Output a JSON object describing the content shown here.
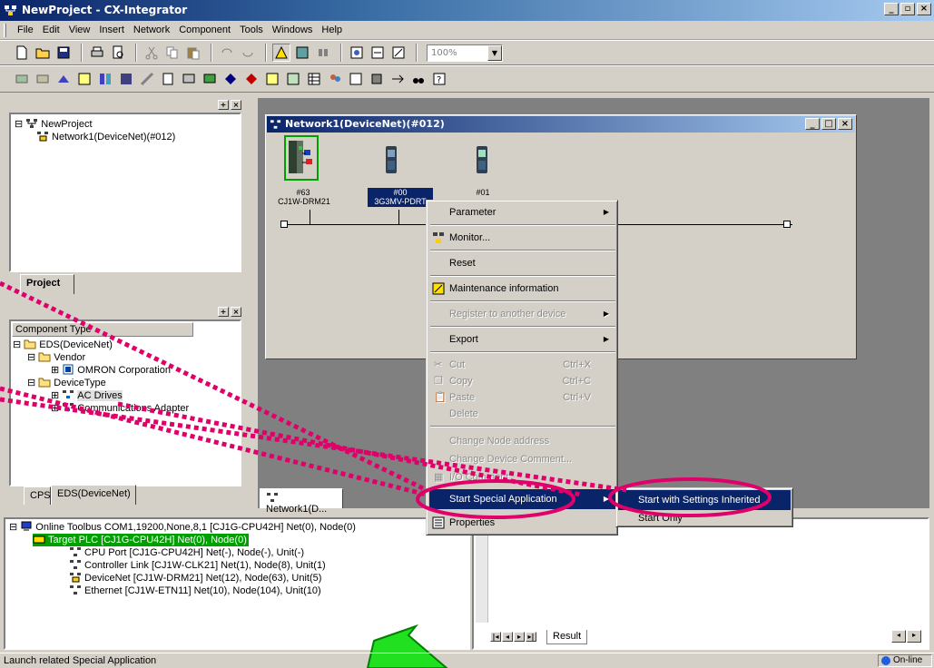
{
  "window": {
    "title": "NewProject - CX-Integrator",
    "min": "_",
    "restore": "8",
    "close": "x"
  },
  "menubar": [
    "File",
    "Edit",
    "View",
    "Insert",
    "Network",
    "Component",
    "Tools",
    "Windows",
    "Help"
  ],
  "toolbar": {
    "zoom_value": "100%"
  },
  "project": {
    "root": "NewProject",
    "network": "Network1(DeviceNet)(#012)",
    "tab_label": "Project"
  },
  "components": {
    "header": "Component Type",
    "root": "EDS(DeviceNet)",
    "vendor": "Vendor",
    "omron": "OMRON Corporation",
    "devicetype": "DeviceType",
    "ac_drives": "AC Drives",
    "comm_adapter": "Communications Adapter",
    "tabs": [
      "CPS",
      "EDS(DeviceNet)"
    ]
  },
  "network_window": {
    "title": "Network1(DeviceNet)(#012)",
    "tab_label": "Network1(D...",
    "nodes": [
      {
        "addr": "#63",
        "model": "CJ1W-DRM21"
      },
      {
        "addr": "#00",
        "model": "3G3MV-PDRT"
      },
      {
        "addr": "#01",
        "model": ""
      }
    ]
  },
  "context_menu": {
    "parameter": "Parameter",
    "monitor": "Monitor...",
    "reset": "Reset",
    "maintenance": "Maintenance information",
    "register": "Register to another device",
    "export": "Export",
    "cut": "Cut",
    "cut_sc": "Ctrl+X",
    "copy": "Copy",
    "copy_sc": "Ctrl+C",
    "paste": "Paste",
    "paste_sc": "Ctrl+V",
    "delete": "Delete",
    "change_node": "Change Node address",
    "change_comment": "Change Device Comment...",
    "io_comment": "I/O Comment",
    "start_special": "Start Special Application",
    "properties": "Properties"
  },
  "submenu": {
    "inherited": "Start with Settings Inherited",
    "only": "Start Only"
  },
  "toolbus": {
    "root": "Online Toolbus COM1,19200,None,8,1 [CJ1G-CPU42H] Net(0), Node(0)",
    "target": "Target PLC [CJ1G-CPU42H] Net(0), Node(0)",
    "cpu": "CPU Port [CJ1G-CPU42H] Net(-), Node(-), Unit(-)",
    "clink": "Controller Link [CJ1W-CLK21] Net(1), Node(8), Unit(1)",
    "devnet": "DeviceNet [CJ1W-DRM21] Net(12), Node(63), Unit(5)",
    "ether": "Ethernet [CJ1W-ETN11] Net(10), Node(104), Unit(10)"
  },
  "result_tab": "Result",
  "status": {
    "text": "Launch related Special Application",
    "online": "On-line"
  },
  "colors": {
    "title_start": "#0a246a",
    "highlight": "#0a246a",
    "annotation": "#e0006a",
    "target_plc_bg": "#00a000"
  }
}
